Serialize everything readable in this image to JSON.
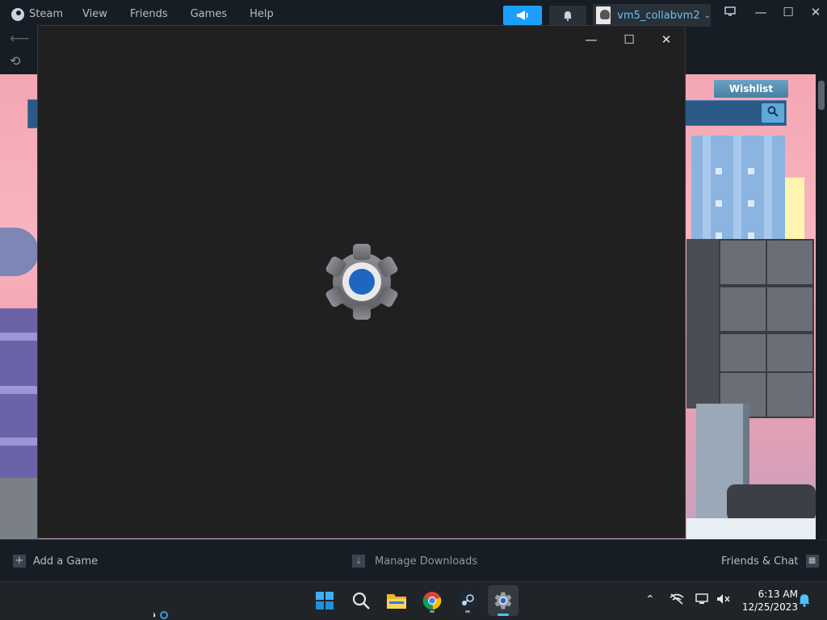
{
  "steam": {
    "menu": {
      "steam": "Steam",
      "view": "View",
      "friends": "Friends",
      "games": "Games",
      "help": "Help"
    },
    "account_name": "vm5_collabvm2",
    "window_controls": {
      "minimize": "—",
      "maximize": "☐",
      "close": "✕"
    },
    "store": {
      "wishlist_label": "Wishlist"
    },
    "bottom": {
      "add_game": "Add a Game",
      "manage_downloads": "Manage Downloads",
      "friends_chat": "Friends & Chat"
    }
  },
  "settings_window": {
    "controls": {
      "minimize": "—",
      "maximize": "☐",
      "close": "✕"
    },
    "icon": "gear-icon",
    "colors": {
      "gear": "#7a7c80",
      "center_ring": "#e8e8e8",
      "center": "#1f66c2"
    }
  },
  "taskbar": {
    "icons": [
      "windows-start-icon",
      "search-icon",
      "file-explorer-icon",
      "chrome-icon",
      "steam-icon",
      "settings-icon"
    ],
    "clock": {
      "time": "6:13 AM",
      "date": "12/25/2023"
    }
  },
  "colors": {
    "accent": "#1a9fff",
    "steam_bg": "#171d25",
    "link": "#67c1f5"
  }
}
